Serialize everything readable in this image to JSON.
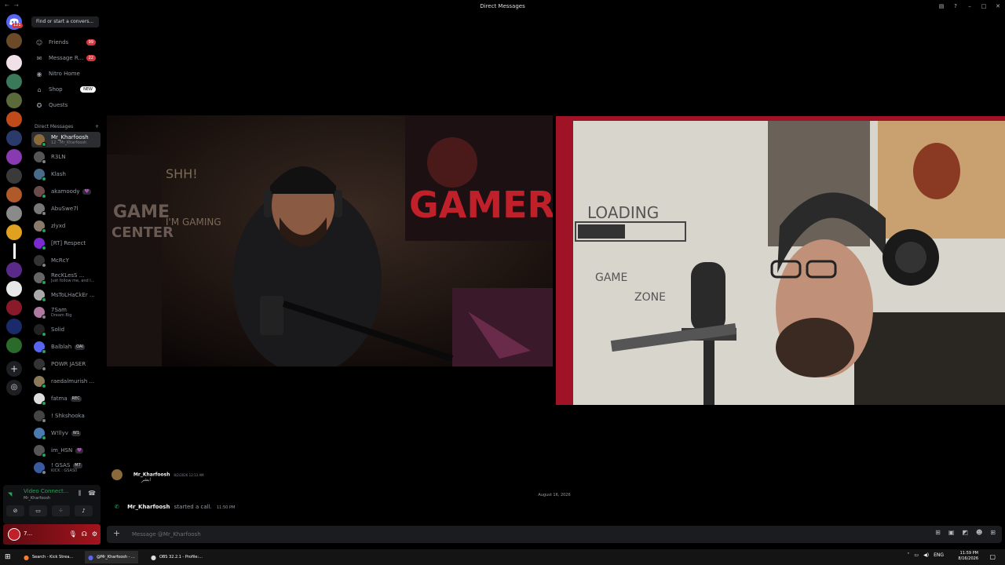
{
  "window": {
    "title": "Direct Messages"
  },
  "guilds": {
    "home_badge": "121"
  },
  "sidebar": {
    "search_placeholder": "Find or start a convers...",
    "nav": [
      {
        "label": "Friends",
        "badge": "99"
      },
      {
        "label": "Message R...",
        "badge": "22"
      },
      {
        "label": "Nitro Home"
      },
      {
        "label": "Shop",
        "pill": "NEW"
      },
      {
        "label": "Quests"
      }
    ],
    "dm_header": "Direct Messages",
    "dms": [
      {
        "name": "Mr_Kharfoosh",
        "sub": "12 · Mr_Kharfoosh",
        "color": "#8a6a3a"
      },
      {
        "name": "R3LN",
        "sub": "",
        "color": "#555"
      },
      {
        "name": "Klash",
        "sub": "",
        "color": "#4a6a8a"
      },
      {
        "name": "akamoody",
        "sub": "",
        "tag": "💜",
        "color": "#6a4a4a"
      },
      {
        "name": "AbuSwe7l",
        "sub": "",
        "color": "#777"
      },
      {
        "name": "zlyxd",
        "sub": "",
        "color": "#8a7a6a"
      },
      {
        "name": "[RT] Respect",
        "sub": "",
        "color": "#7a2ad0"
      },
      {
        "name": "McRcY",
        "sub": "",
        "color": "#333"
      },
      {
        "name": "RecKLesS ...",
        "sub": "Just follow me, and I...",
        "color": "#666"
      },
      {
        "name": "MsToLHaCkEr ...",
        "sub": "",
        "color": "#aaa"
      },
      {
        "name": "7Sam",
        "sub": "Dream Big",
        "color": "#b07aa0"
      },
      {
        "name": "Solid",
        "sub": "",
        "color": "#222"
      },
      {
        "name": "Balblah",
        "sub": "",
        "tag": "OAI",
        "color": "#5865f2"
      },
      {
        "name": "POWR JASER",
        "sub": "",
        "color": "#333"
      },
      {
        "name": "raedalmurish ...",
        "sub": "",
        "color": "#8a7a5a"
      },
      {
        "name": "fatma",
        "sub": "",
        "tag": "REC",
        "color": "#ddd"
      },
      {
        "name": "! Shkshooka",
        "sub": "",
        "color": "#444"
      },
      {
        "name": "W!llyv",
        "sub": "",
        "tag": "W1",
        "color": "#4a7ab0"
      },
      {
        "name": "im_HSN",
        "sub": "",
        "tag": "💜",
        "color": "#555"
      },
      {
        "name": "! GSAS",
        "sub": "KICK : GSAS0",
        "tag": "M7",
        "color": "#3a5aa0"
      }
    ]
  },
  "voice": {
    "status": "Video Connect...",
    "channel": "Mr_Kharfoosh",
    "self_label": "7..."
  },
  "chat": {
    "prev_author": "Mr_Kharfoosh",
    "prev_time": "8/2/2026 12:13 AM",
    "prev_text": "ابشر",
    "date_divider": "August 16, 2026",
    "call_author": "Mr_Kharfoosh",
    "call_text": "started a call.",
    "call_time": "11:50 PM",
    "composer_placeholder": "Message @Mr_Kharfoosh"
  },
  "taskbar": {
    "apps": [
      {
        "label": "Search - Kick Strea..."
      },
      {
        "label": "@Mr_Kharfoosh - ..."
      },
      {
        "label": "OBS 32.2.1 - Profile:..."
      }
    ],
    "lang": "ENG",
    "time": "11:59 PM",
    "date": "8/16/2026"
  },
  "colors": {
    "accent": "#5865f2",
    "online": "#23a55a",
    "danger": "#da373c"
  }
}
